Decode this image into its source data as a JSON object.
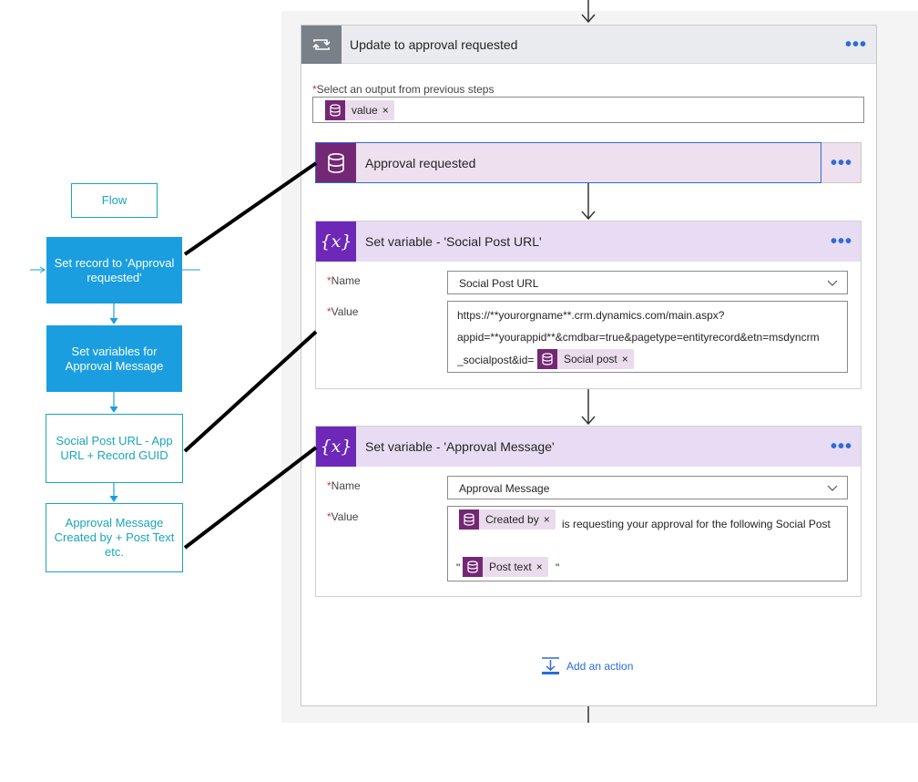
{
  "scope": {
    "title": "Update to approval requested",
    "more": "•••"
  },
  "select_output": {
    "required_mark": "*",
    "label": "Select an output from previous steps",
    "token": "value",
    "remove": "×"
  },
  "approval_card": {
    "title": "Approval requested",
    "more": "•••"
  },
  "set_var_url": {
    "title": "Set variable - 'Social Post URL'",
    "more": "•••",
    "icon_text": "{x}",
    "required_mark": "*",
    "name_label": "Name",
    "name_value": "Social Post URL",
    "value_label": "Value",
    "value_line1": "https://**yourorgname**.crm.dynamics.com/main.aspx?",
    "value_line2": "appid=**yourappid**&cmdbar=true&pagetype=entityrecord&etn=msdyncrm",
    "value_line3": "_socialpost&id=",
    "token": "Social post",
    "remove": "×"
  },
  "set_var_msg": {
    "title": "Set variable - 'Approval Message'",
    "more": "•••",
    "icon_text": "{x}",
    "required_mark": "*",
    "name_label": "Name",
    "name_value": "Approval Message",
    "value_label": "Value",
    "token1": "Created by",
    "remove": "×",
    "text_after": "is requesting your approval for the following Social Post",
    "quote_open": "\"",
    "token2": "Post text",
    "quote_close": "\""
  },
  "add_action": {
    "label": "Add an action"
  },
  "flow_diagram": {
    "header": "Flow",
    "step1": "Set record to 'Approval requested'",
    "step2": "Set variables for Approval Message",
    "step3": "Social Post URL - App URL + Record GUID",
    "step4": "Approval Message Created by + Post Text etc."
  },
  "colors": {
    "accent": "#2b6cd8",
    "dataverse_purple": "#742774",
    "variable_purple": "#6d28b8",
    "flow_blue": "#1a9ee0",
    "flow_teal": "#18a6b8"
  }
}
